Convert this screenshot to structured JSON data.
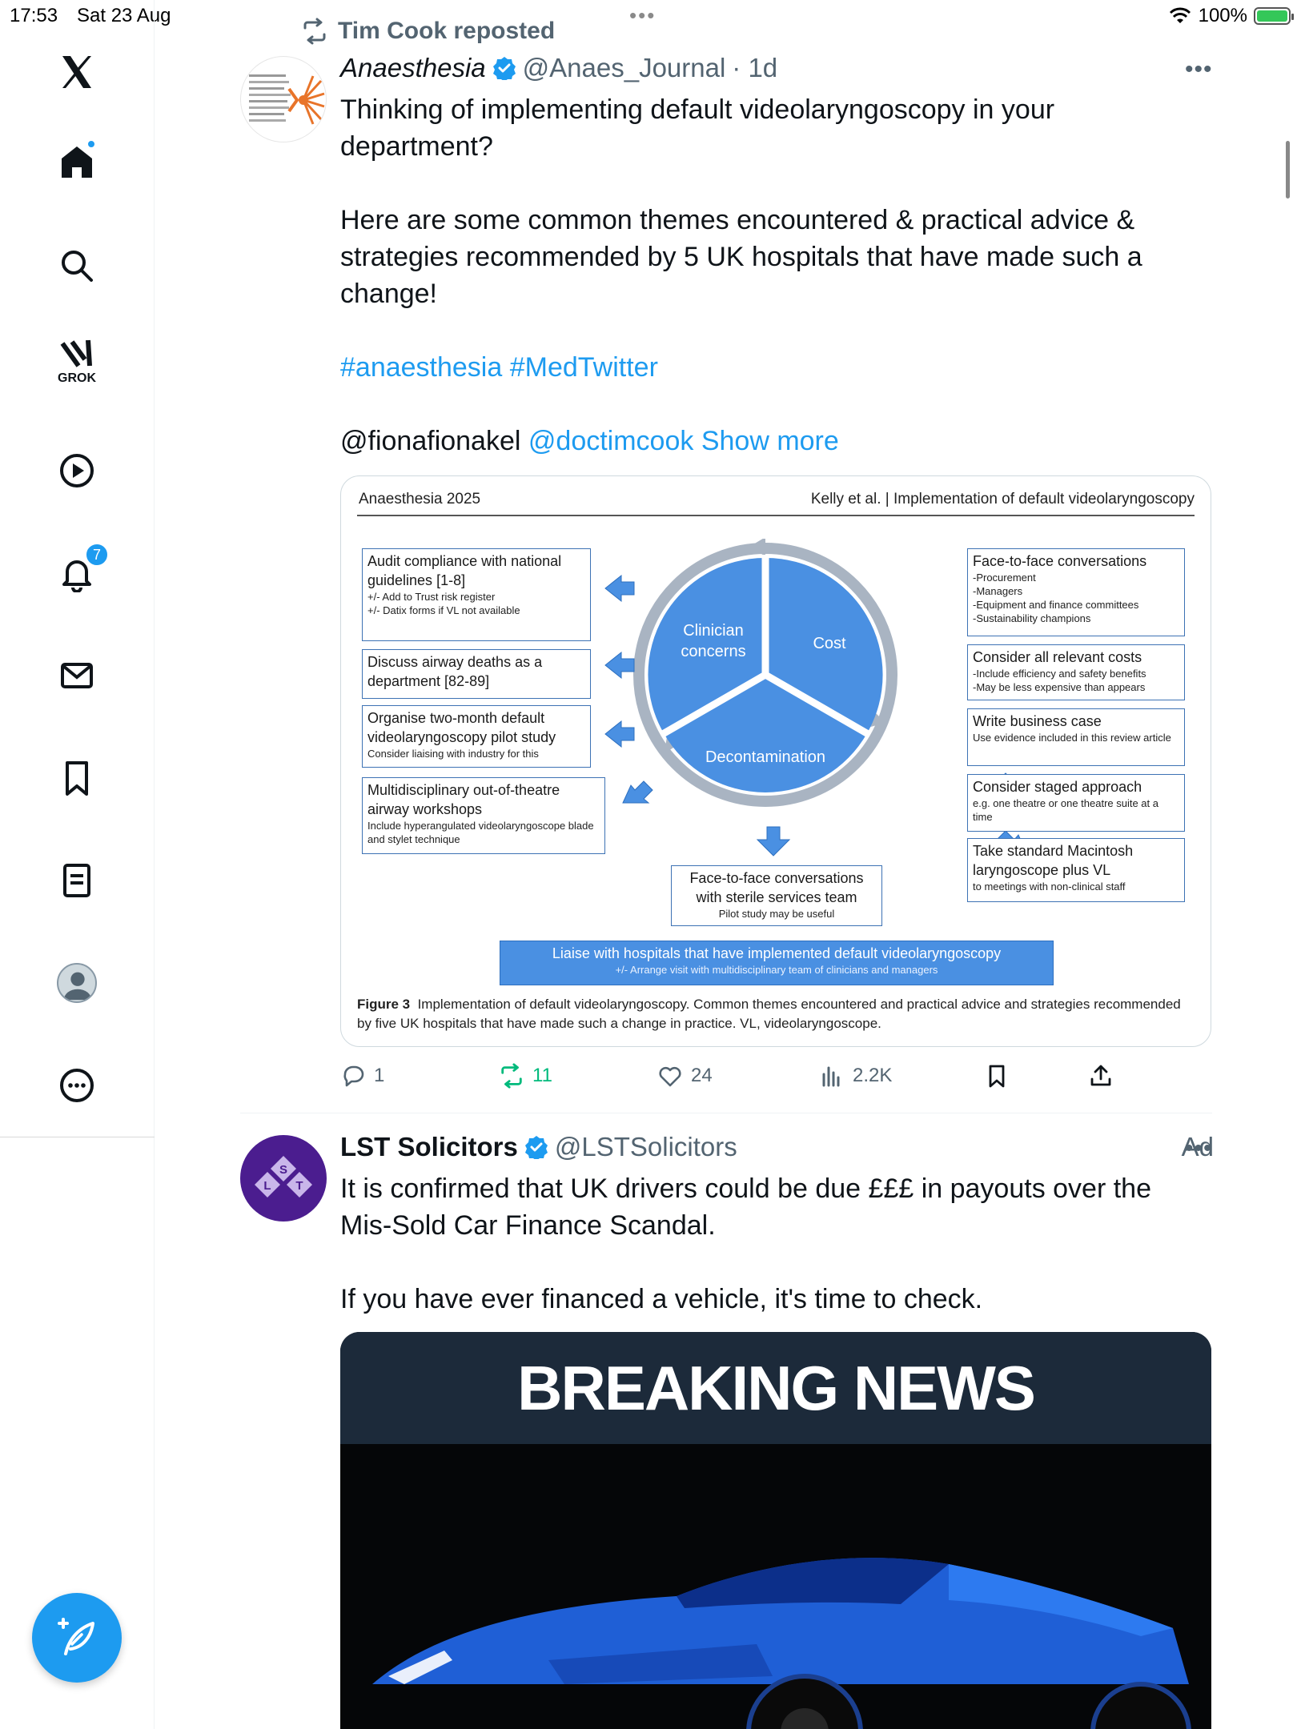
{
  "status_bar": {
    "time": "17:53",
    "date": "Sat 23 Aug",
    "battery": "100%"
  },
  "sidebar": {
    "grok_label": "GROK",
    "notifications_count": "7",
    "accent_color": "#1d9bf0"
  },
  "repost": {
    "label": "Tim Cook reposted"
  },
  "tweet1": {
    "author_name": "Anaesthesia",
    "handle": "@Anaes_Journal",
    "time": "· 1d",
    "text_line1": "Thinking of implementing default videolaryngoscopy in your department?",
    "text_line2": "Here are some common themes encountered & practical advice & strategies recommended by 5 UK hospitals that have made such a change!",
    "hashtags": "#anaesthesia #MedTwitter",
    "mention_plain": "@fionafionakel",
    "mention_link": "@doctimcook",
    "show_more": "Show more",
    "figure": {
      "header_left": "Anaesthesia 2025",
      "header_right": "Kelly et al.  |  Implementation of default videolaryngoscopy",
      "circle": {
        "clinician": "Clinician concerns",
        "cost": "Cost",
        "decontamination": "Decontamination"
      },
      "left_boxes": [
        {
          "title": "Audit compliance with national guidelines [1-8]",
          "sub1": "+/- Add to Trust risk register",
          "sub2": "+/- Datix forms if VL not available"
        },
        {
          "title": "Discuss airway deaths as a department [82-89]"
        },
        {
          "title": "Organise two-month default videolaryngoscopy pilot study",
          "sub1": "Consider liaising with industry for this"
        },
        {
          "title": "Multidisciplinary out-of-theatre airway workshops",
          "sub1": "Include hyperangulated videolaryngoscope blade and stylet technique"
        }
      ],
      "right_boxes": [
        {
          "title": "Face-to-face conversations",
          "sub1": "-Procurement",
          "sub2": "-Managers",
          "sub3": "-Equipment and finance committees",
          "sub4": "-Sustainability champions"
        },
        {
          "title": "Consider all relevant costs",
          "sub1": "-Include efficiency and safety benefits",
          "sub2": "-May be less expensive than appears"
        },
        {
          "title": "Write business case",
          "sub1": "Use evidence  included in this review article"
        },
        {
          "title": "Consider staged approach",
          "sub1": "e.g. one theatre or one theatre suite at a time"
        },
        {
          "title": "Take standard Macintosh laryngoscope plus VL",
          "sub1": "to meetings with non-clinical staff"
        }
      ],
      "bottom_box": {
        "line1": "Face-to-face conversations",
        "line2": "with sterile services team",
        "sub1": "Pilot study may be useful"
      },
      "banner": {
        "line1": "Liaise with hospitals that have implemented default videolaryngoscopy",
        "line2": "+/- Arrange visit with multidisciplinary team of clinicians and managers"
      },
      "caption_label": "Figure 3",
      "caption_text": "Implementation of default videolaryngoscopy. Common themes encountered and practical advice and strategies recommended by five UK hospitals that have made such a change in practice.  VL, videolaryngoscope."
    },
    "actions": {
      "replies": "1",
      "reposts": "11",
      "likes": "24",
      "views": "2.2K"
    }
  },
  "tweet2": {
    "author_name": "LST Solicitors",
    "handle": "@LSTSolicitors",
    "ad_label": "Ad",
    "avatar_letters": [
      "S",
      "L",
      "T"
    ],
    "avatar_color": "#4b1d8f",
    "text_line1": "It is confirmed that UK drivers could be due £££ in payouts over the Mis-Sold Car Finance Scandal.",
    "text_line2": "If you have ever financed a vehicle, it's time to check.",
    "media_headline": "BREAKING NEWS"
  }
}
